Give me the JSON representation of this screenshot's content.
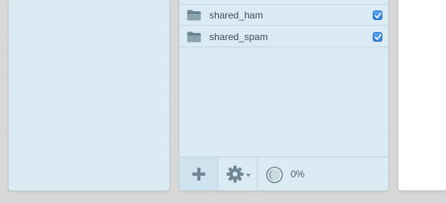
{
  "folders": [
    {
      "name": "shared_ham",
      "checked": true
    },
    {
      "name": "shared_spam",
      "checked": true
    }
  ],
  "toolbar": {
    "add_icon": "plus-icon",
    "settings_icon": "gear-icon",
    "progress_icon": "circular-progress-icon",
    "progress_value": 0,
    "progress_text": "0%"
  },
  "colors": {
    "panel": "#daebf3",
    "checkbox": "#3a8ee6",
    "icon": "#7d959f",
    "text": "#3c4a52"
  }
}
